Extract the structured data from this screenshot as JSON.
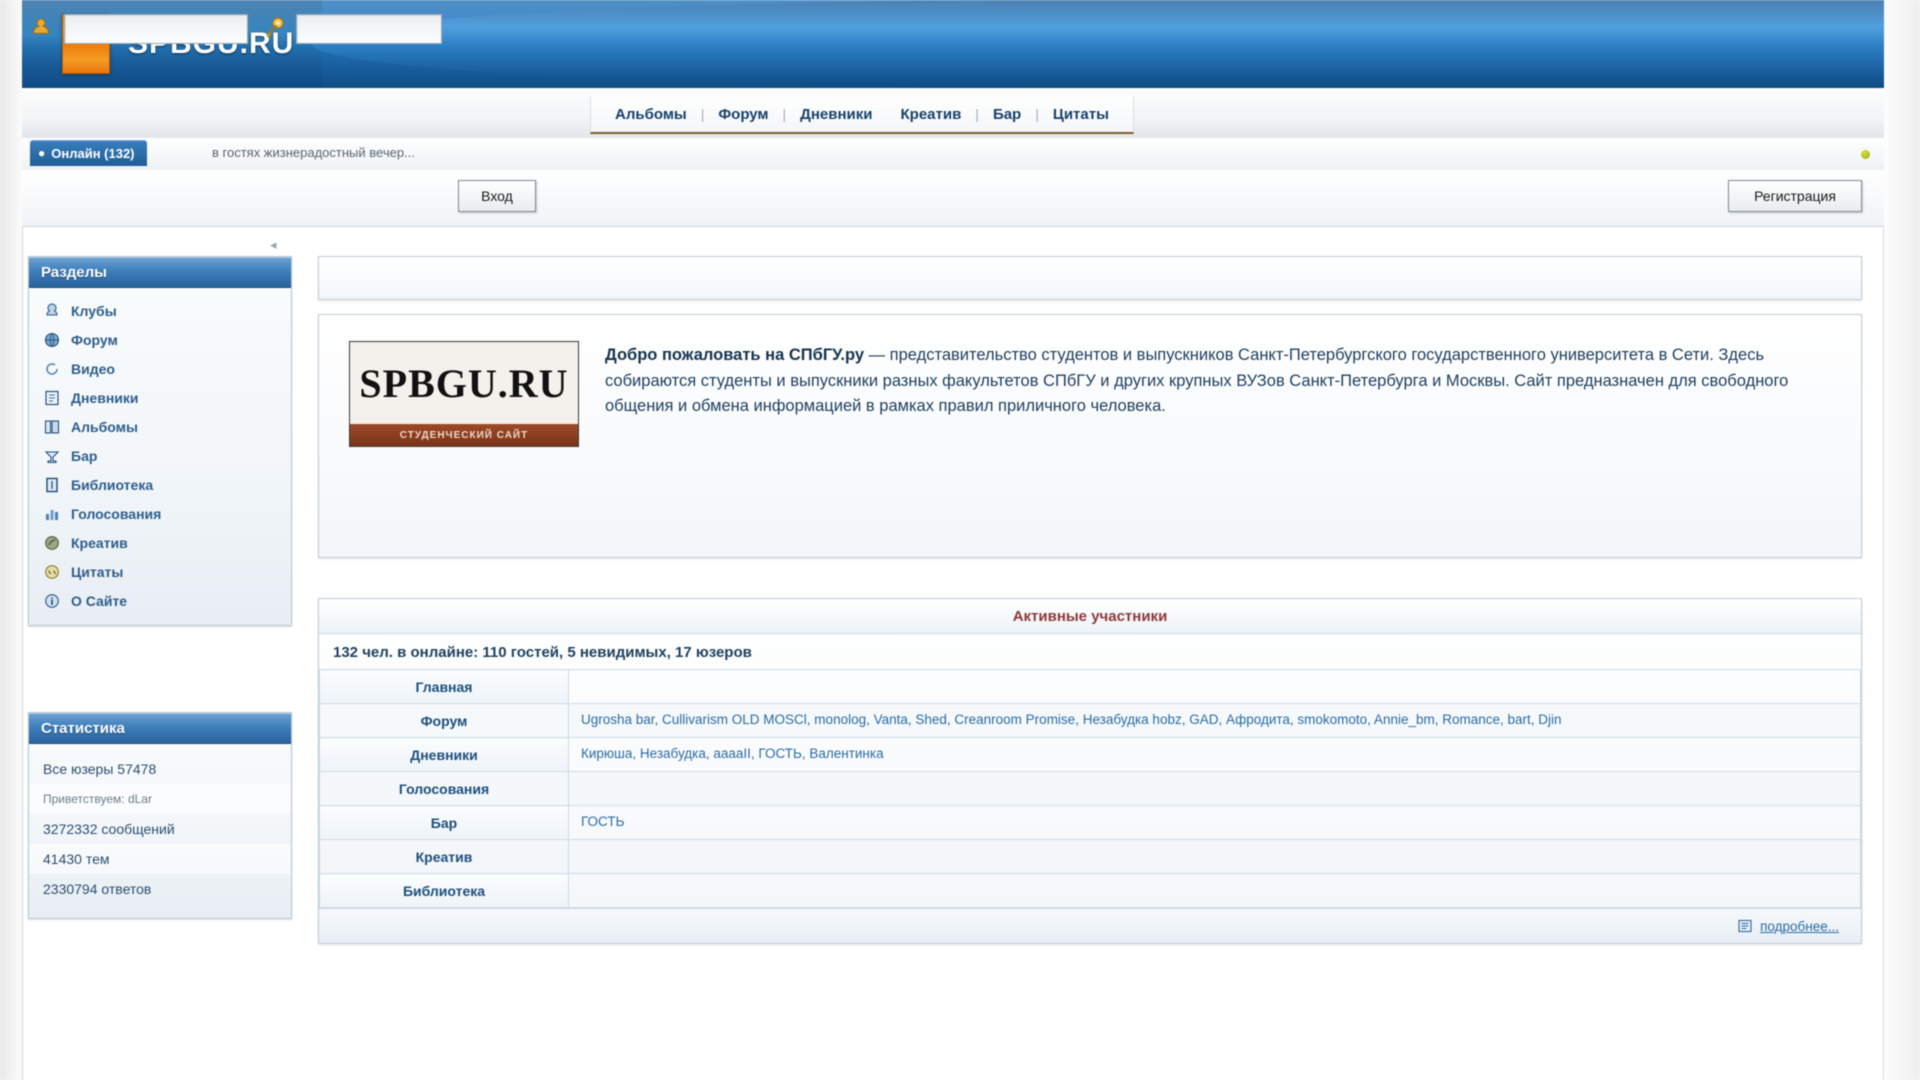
{
  "site": {
    "brand": "SPBGU.RU",
    "logo_card_text": "SPBGU.RU",
    "logo_card_sub": "СТУДЕНЧЕСКИЙ САЙТ"
  },
  "nav": {
    "items": [
      {
        "label": "Альбомы"
      },
      {
        "label": "Форум"
      },
      {
        "label": "Дневники"
      },
      {
        "label": "Креатив"
      },
      {
        "label": "Бар"
      },
      {
        "label": "Цитаты"
      }
    ],
    "separator": "|"
  },
  "crumb": {
    "tab_label": "Онлайн (132)",
    "tab_icon": "users-icon",
    "text": "в гостях жизнерадостный вечер..."
  },
  "login": {
    "user_icon": "user-icon",
    "key_icon": "key-icon",
    "login_value": "",
    "login_placeholder": "",
    "password_value": "",
    "password_placeholder": "",
    "enter_label": "Вход",
    "register_label": "Регистрация"
  },
  "sidebar": {
    "sections": {
      "title": "Разделы",
      "items": [
        {
          "label": "Клубы",
          "icon": "club-icon"
        },
        {
          "label": "Форум",
          "icon": "forum-icon"
        },
        {
          "label": "Видео",
          "icon": "video-icon"
        },
        {
          "label": "Дневники",
          "icon": "diary-icon"
        },
        {
          "label": "Альбомы",
          "icon": "album-icon"
        },
        {
          "label": "Бар",
          "icon": "bar-icon"
        },
        {
          "label": "Библиотека",
          "icon": "library-icon"
        },
        {
          "label": "Голосования",
          "icon": "poll-icon"
        },
        {
          "label": "Креатив",
          "icon": "creative-icon"
        },
        {
          "label": "Цитаты",
          "icon": "quote-icon"
        },
        {
          "label": "О Сайте",
          "icon": "about-icon"
        }
      ]
    },
    "stats": {
      "title": "Статистика",
      "rows": [
        {
          "text": "Все юзеры 57478"
        },
        {
          "text": "Приветствуем: dLar"
        },
        {
          "text": "3272332 сообщений"
        },
        {
          "text": "41430 тем"
        },
        {
          "text": "2330794 ответов"
        }
      ]
    }
  },
  "welcome": {
    "lead": "Добро пожаловать на СПбГУ.ру",
    "body": " — представительство студентов и выпускников Санкт-Петербургского государственного университета в Сети. Здесь собираются студенты и выпускники разных факультетов СПбГУ и других крупных ВУЗов Санкт-Петербурга и Москвы. Сайт предназначен для свободного общения и обмена информацией в рамках правил приличного человека."
  },
  "active": {
    "header": "Активные участники",
    "online_line": "132 чел. в онлайне: 110 гостей, 5 невидимых, 17 юзеров",
    "rows": [
      {
        "label": "Главная",
        "users": ""
      },
      {
        "label": "Форум",
        "users": "Ugrosha bar, Cullivarism OLD MOSCl, monolog, Vanta, Shed, Creanroom Promise, Незабудка hobz, GAD, Афродита, smokomoto, Annie_bm, Romance, bart, Djin"
      },
      {
        "label": "Дневники",
        "users": "Кирюша, Незабудка, aaaaII, ГОСТЬ, Валентинка"
      },
      {
        "label": "Голосования",
        "users": ""
      },
      {
        "label": "Бар",
        "users": "ГОСТЬ"
      },
      {
        "label": "Креатив",
        "users": ""
      },
      {
        "label": "Библиотека",
        "users": ""
      }
    ],
    "footer_link": "подробнее...",
    "footer_icon": "list-icon"
  },
  "colors": {
    "banner_blue": "#2f86cf",
    "accent_orange": "#f08a12",
    "panel_head_blue": "#3f7fbc",
    "link_blue": "#2b6ca3",
    "header_red": "#8d3a3a"
  }
}
